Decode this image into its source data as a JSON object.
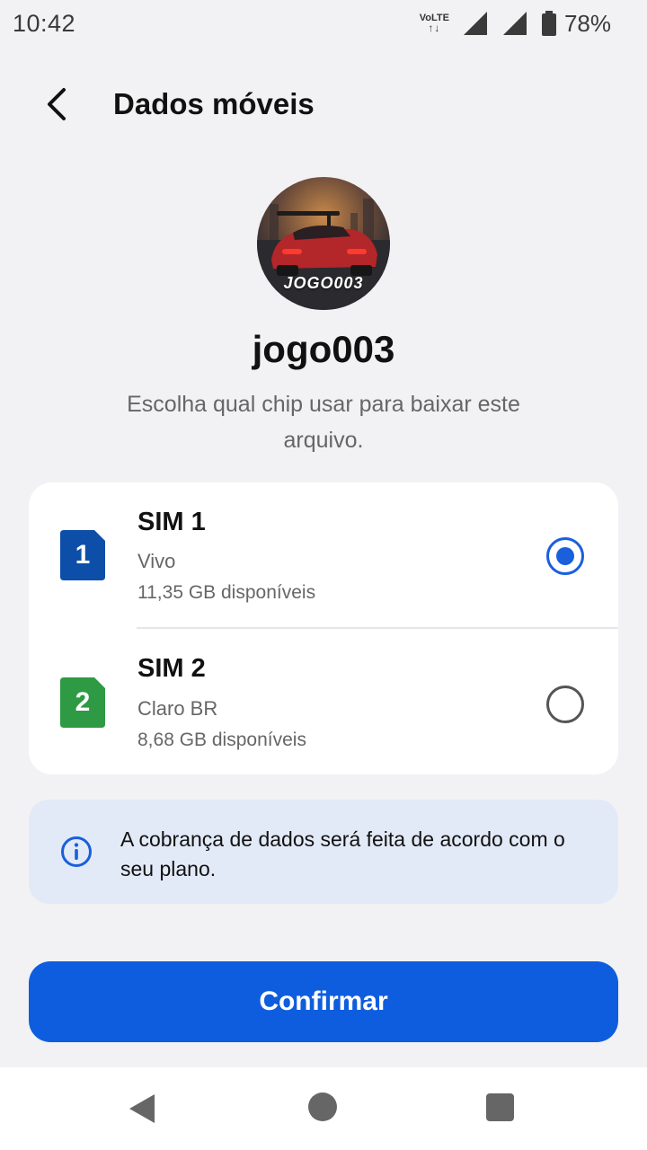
{
  "status_bar": {
    "time": "10:42",
    "volte_label": "VoLTE",
    "volte_arrows": "↑↓",
    "battery_percent": "78%"
  },
  "app_bar": {
    "title": "Dados móveis"
  },
  "file": {
    "avatar_caption": "JOGO003",
    "name": "jogo003",
    "prompt": "Escolha qual chip usar para baixar este arquivo."
  },
  "sims": [
    {
      "number": "1",
      "name": "SIM 1",
      "carrier": "Vivo",
      "available": "11,35 GB disponíveis",
      "selected": true,
      "color": "#0d4fa8"
    },
    {
      "number": "2",
      "name": "SIM 2",
      "carrier": "Claro BR",
      "available": "8,68 GB disponíveis",
      "selected": false,
      "color": "#2e9a43"
    }
  ],
  "info": {
    "icon": "info-icon",
    "text": "A cobrança de dados será feita de acordo com o seu plano."
  },
  "actions": {
    "confirm_label": "Confirmar"
  },
  "colors": {
    "accent": "#0f5ddf",
    "background": "#f2f2f4",
    "info_background": "#e3eaf7"
  }
}
